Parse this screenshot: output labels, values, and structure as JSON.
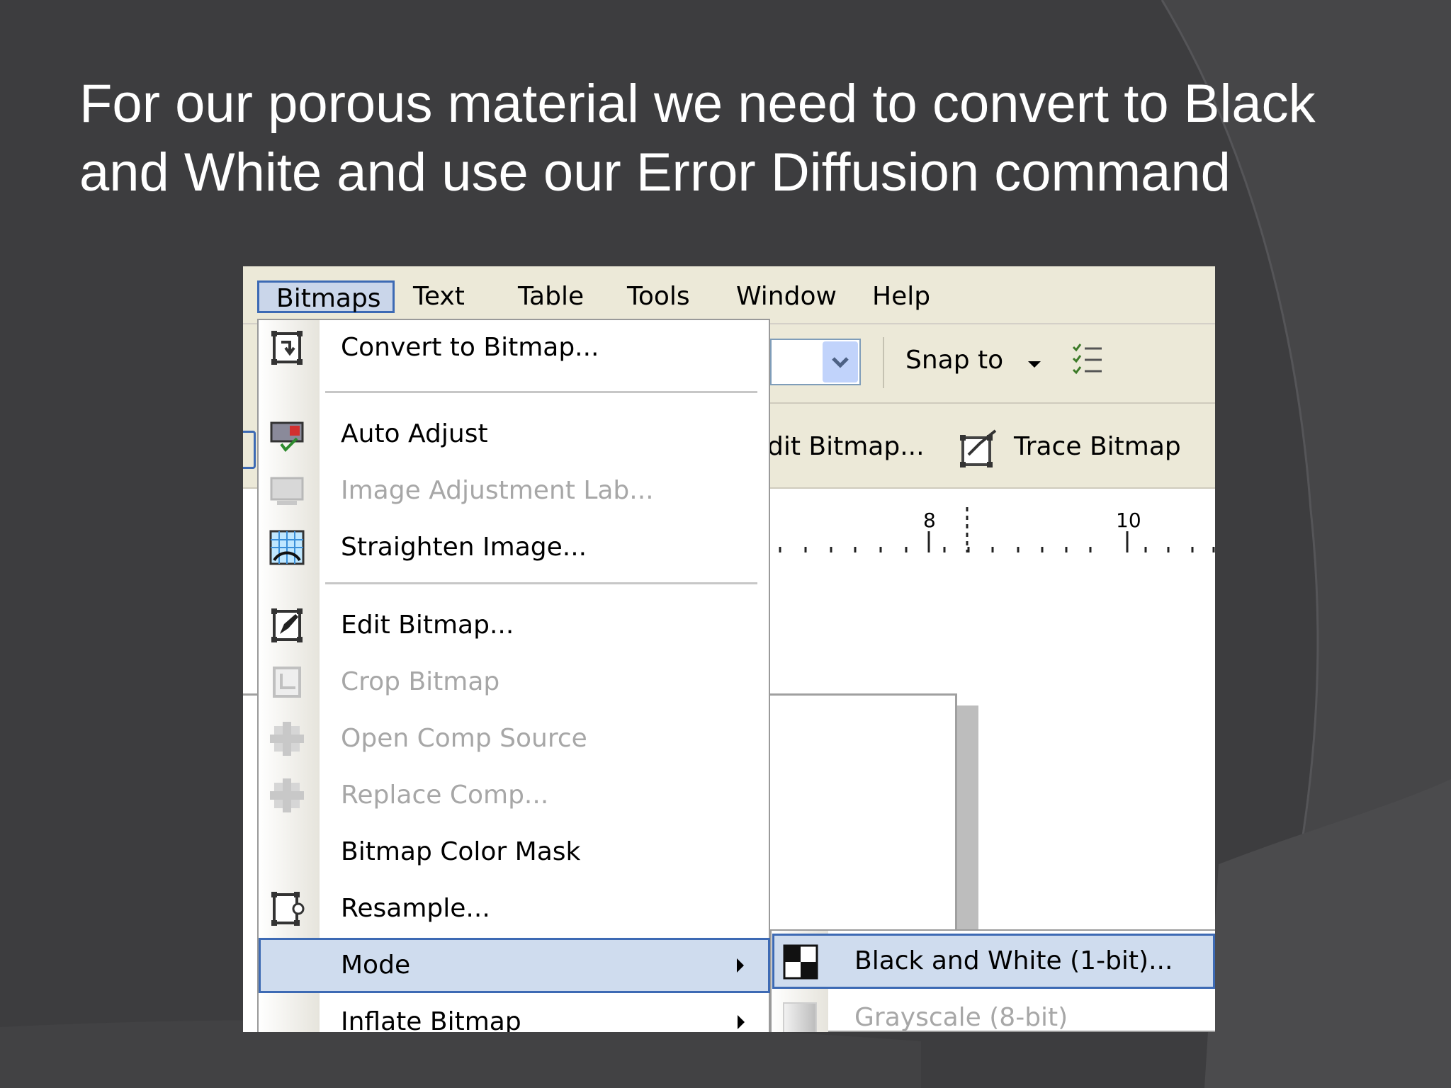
{
  "slide": {
    "title": "For our porous material we need to convert to Black and White and use our Error Diffusion command"
  },
  "menubar": {
    "items": [
      {
        "label": "Bitmaps",
        "key": "B"
      },
      {
        "label": "Text",
        "key": "x"
      },
      {
        "label": "Table",
        "key": "T"
      },
      {
        "label": "Tools",
        "key": "o"
      },
      {
        "label": "Window",
        "key": "W"
      },
      {
        "label": "Help",
        "key": "H"
      }
    ]
  },
  "toolbar": {
    "snap_to": "Snap to",
    "edit_bitmap_partial": "dit Bitmap...",
    "trace_bitmap": "Trace Bitmap"
  },
  "ruler": {
    "labels": [
      "8",
      "10"
    ]
  },
  "bitmaps_menu": {
    "items": [
      {
        "label": "Convert to Bitmap...",
        "icon": "convert-bitmap-icon",
        "enabled": true
      },
      {
        "label": "Auto Adjust",
        "icon": "auto-adjust-icon",
        "enabled": true
      },
      {
        "label": "Image Adjustment Lab...",
        "icon": "image-adjustment-icon",
        "enabled": false
      },
      {
        "label": "Straighten Image...",
        "icon": "straighten-image-icon",
        "enabled": true
      },
      {
        "label": "Edit Bitmap...",
        "icon": "edit-bitmap-icon",
        "enabled": true
      },
      {
        "label": "Crop Bitmap",
        "icon": "crop-bitmap-icon",
        "enabled": false
      },
      {
        "label": "Open Comp Source",
        "icon": "open-comp-icon",
        "enabled": false
      },
      {
        "label": "Replace Comp...",
        "icon": "replace-comp-icon",
        "enabled": false
      },
      {
        "label": "Bitmap Color Mask",
        "icon": "",
        "enabled": true
      },
      {
        "label": "Resample...",
        "icon": "resample-icon",
        "enabled": true
      },
      {
        "label": "Mode",
        "icon": "",
        "enabled": true,
        "submenu": true,
        "highlighted": true
      },
      {
        "label": "Inflate Bitmap",
        "icon": "",
        "enabled": true,
        "submenu": true
      }
    ]
  },
  "mode_submenu": {
    "items": [
      {
        "label": "Black and White (1-bit)...",
        "icon": "black-white-icon",
        "enabled": true,
        "highlighted": true
      },
      {
        "label": "Grayscale (8-bit)",
        "icon": "grayscale-icon",
        "enabled": false
      }
    ]
  },
  "colors": {
    "background": "#3d3d3f",
    "menu_highlight": "#cfdcee",
    "highlight_border": "#3d6ab4",
    "disabled_text": "#a7a7a7"
  }
}
